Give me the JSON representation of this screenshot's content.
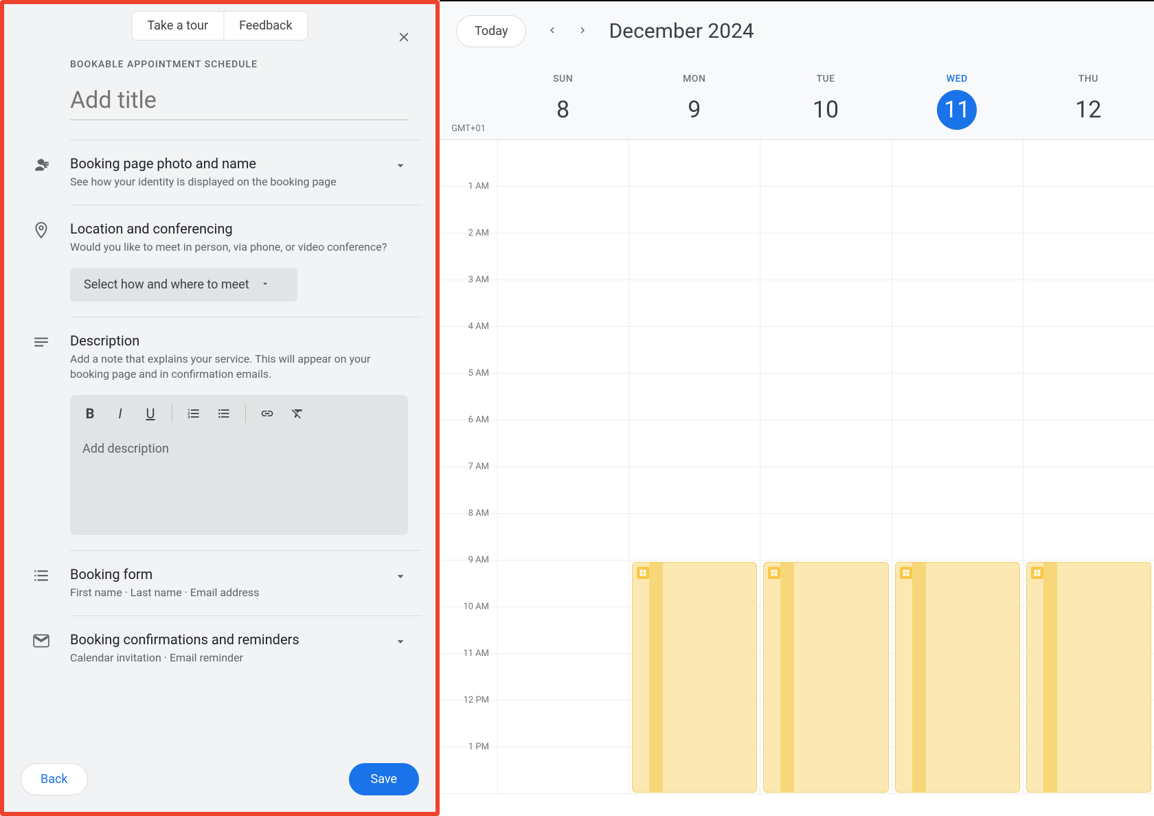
{
  "top_buttons": {
    "take_tour": "Take a tour",
    "feedback": "Feedback"
  },
  "panel": {
    "label": "BOOKABLE APPOINTMENT SCHEDULE",
    "title_placeholder": "Add title",
    "sections": {
      "booking_photo": {
        "title": "Booking page photo and name",
        "sub": "See how your identity is displayed on the booking page"
      },
      "location": {
        "title": "Location and conferencing",
        "sub": "Would you like to meet in person, via phone, or video conference?",
        "select_label": "Select how and where to meet"
      },
      "description": {
        "title": "Description",
        "sub": "Add a note that explains your service. This will appear on your booking page and in confirmation emails.",
        "placeholder": "Add description"
      },
      "booking_form": {
        "title": "Booking form",
        "sub": "First name · Last name · Email address"
      },
      "confirmations": {
        "title": "Booking confirmations and reminders",
        "sub": "Calendar invitation · Email reminder"
      }
    }
  },
  "footer": {
    "back": "Back",
    "save": "Save"
  },
  "calendar": {
    "today": "Today",
    "title": "December 2024",
    "timezone": "GMT+01",
    "days": [
      {
        "name": "SUN",
        "num": "8",
        "active": false
      },
      {
        "name": "MON",
        "num": "9",
        "active": false
      },
      {
        "name": "TUE",
        "num": "10",
        "active": false
      },
      {
        "name": "WED",
        "num": "11",
        "active": true
      },
      {
        "name": "THU",
        "num": "12",
        "active": false
      }
    ],
    "hours": [
      "",
      "1 AM",
      "2 AM",
      "3 AM",
      "4 AM",
      "5 AM",
      "6 AM",
      "7 AM",
      "8 AM",
      "9 AM",
      "10 AM",
      "11 AM",
      "12 PM",
      "1 PM"
    ]
  }
}
